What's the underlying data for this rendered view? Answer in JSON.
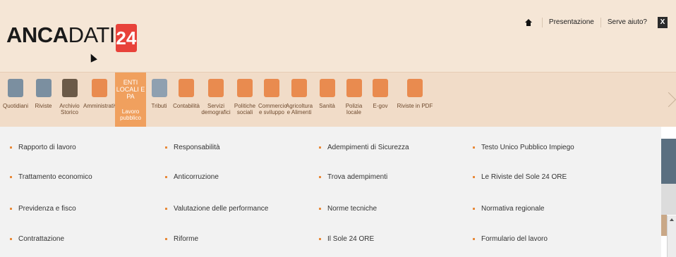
{
  "header": {
    "logo": {
      "part1": "ANCA",
      "part2": "DATI",
      "part3": "24"
    },
    "links": [
      "Presentazione",
      "Serve aiuto?"
    ],
    "close_label": "X"
  },
  "nav": {
    "items": [
      {
        "label1": "Quotidiani",
        "label2": "",
        "icon": "newspaper-icon",
        "color": "#7b8fa0"
      },
      {
        "label1": "Riviste",
        "label2": "",
        "icon": "magazine-icon",
        "color": "#7b8fa0"
      },
      {
        "label1": "Archivio",
        "label2": "Storico",
        "icon": "archive-24-icon",
        "color": "#6b5a48"
      },
      {
        "label1": "Amministrativo",
        "label2": "",
        "icon": "dome-icon",
        "color": "#e98b4f"
      },
      {
        "label1": "Lavoro",
        "label2": "pubblico",
        "enti": "ENTI LOCALI E PA",
        "icon": "",
        "color": "#f0a05e",
        "active": true
      },
      {
        "label1": "Tributi",
        "label2": "",
        "icon": "tax-icon",
        "color": "#8fa0b0"
      },
      {
        "label1": "Contabilità",
        "label2": "",
        "icon": "calculator-icon",
        "color": "#e98b4f"
      },
      {
        "label1": "Servizi",
        "label2": "demografici",
        "icon": "people-icon",
        "color": "#e98b4f"
      },
      {
        "label1": "Politiche",
        "label2": "sociali",
        "icon": "group-icon",
        "color": "#e98b4f"
      },
      {
        "label1": "Commercio",
        "label2": "e sviluppo",
        "icon": "shopping-icon",
        "color": "#e98b4f"
      },
      {
        "label1": "Agricoltura",
        "label2": "e Alimenti",
        "icon": "leaf-icon",
        "color": "#e98b4f"
      },
      {
        "label1": "Sanità",
        "label2": "",
        "icon": "medical-kit-icon",
        "color": "#e98b4f"
      },
      {
        "label1": "Polizia",
        "label2": "locale",
        "icon": "police-icon",
        "color": "#e98b4f"
      },
      {
        "label1": "E-gov",
        "label2": "",
        "icon": "e-gov-icon",
        "color": "#e98b4f"
      },
      {
        "label1": "Riviste in PDF",
        "label2": "",
        "icon": "pa-pdf-icon",
        "color": "#e98b4f"
      }
    ]
  },
  "menu": {
    "columns": [
      [
        "Rapporto di lavoro",
        "Trattamento economico",
        "Previdenza e fisco",
        "Contrattazione"
      ],
      [
        "Responsabilità",
        "Anticorruzione",
        "Valutazione delle performance",
        "Riforme"
      ],
      [
        "Adempimenti di Sicurezza",
        "Trova adempimenti",
        "Norme tecniche",
        "Il Sole 24 ORE"
      ],
      [
        "Testo Unico Pubblico Impiego",
        "Le Riviste del Sole 24 ORE",
        "Normativa regionale",
        "Formulario del lavoro"
      ]
    ]
  },
  "colors": {
    "header_bg": "#f5e6d6",
    "nav_bg": "#f1dcc8",
    "active_tab": "#f0a05e",
    "accent": "#e88a3a",
    "logo_red": "#e8423a"
  }
}
